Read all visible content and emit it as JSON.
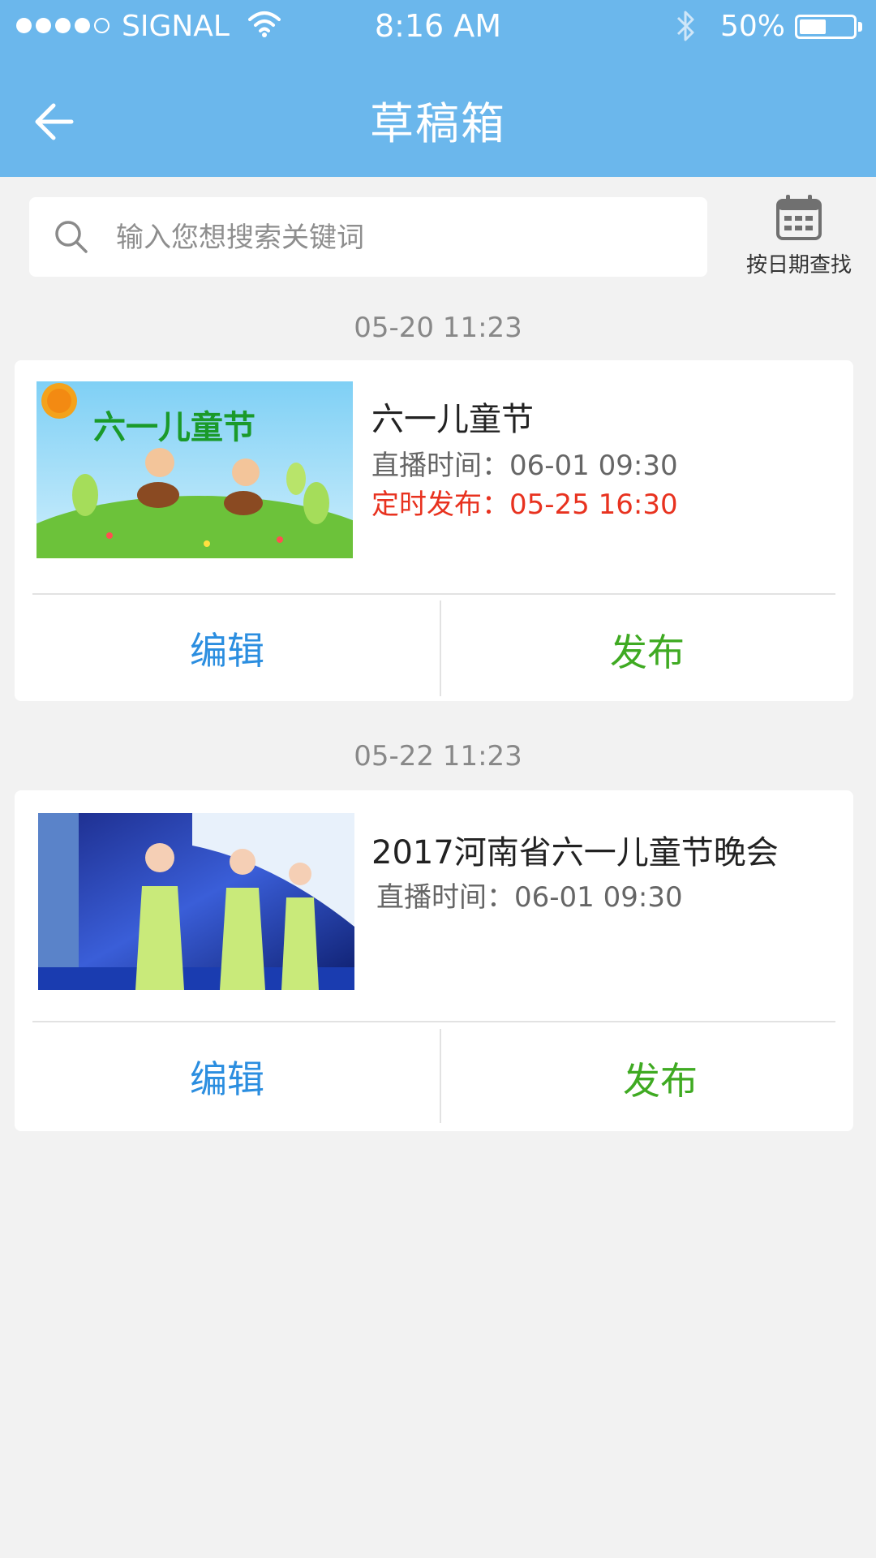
{
  "status_bar": {
    "carrier": "SIGNAL",
    "time": "8:16 AM",
    "battery_percent_text": "50%",
    "battery_level": 0.5,
    "signal_bars_filled": 4,
    "signal_bars_total": 5
  },
  "nav": {
    "title": "草稿箱",
    "back_icon": "arrow-left-icon"
  },
  "search": {
    "placeholder": "输入您想搜索关键词",
    "icon": "search-icon"
  },
  "date_search": {
    "label": "按日期查找",
    "icon": "calendar-icon"
  },
  "drafts": [
    {
      "date": "05-20 11:23",
      "title": "六一儿童节",
      "live_time": "直播时间：06-01 09:30",
      "scheduled_publish": "定时发布：05-25 16:30",
      "thumb_text": "六一儿童节",
      "edit_label": "编辑",
      "publish_label": "发布"
    },
    {
      "date": "05-22 11:23",
      "title": "2017河南省六一儿童节晚会",
      "live_time": "直播时间：06-01 09:30",
      "edit_label": "编辑",
      "publish_label": "发布"
    }
  ],
  "colors": {
    "nav_bg": "#6bb7ec",
    "edit": "#2b8ee0",
    "publish": "#3faa22",
    "scheduled": "#e8321f"
  }
}
